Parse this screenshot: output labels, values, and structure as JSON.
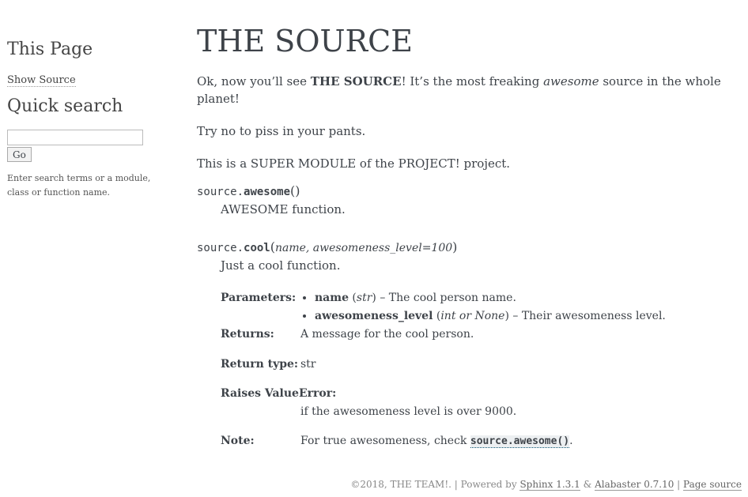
{
  "sidebar": {
    "this_page_title": "This Page",
    "show_source": "Show Source",
    "quick_search_title": "Quick search",
    "search_value": "",
    "go_label": "Go",
    "help_text": "Enter search terms or a module, class or function name."
  },
  "main": {
    "title": "THE SOURCE",
    "intro": {
      "part1": "Ok, now you’ll see ",
      "bold": "THE SOURCE",
      "part2": "! It’s the most freaking ",
      "em": "awesome",
      "part3": " source in the whole planet!"
    },
    "p2": "Try no to piss in your pants.",
    "p3": "This is a SUPER MODULE of the PROJECT! project.",
    "func1": {
      "module": "source.",
      "name": "awesome",
      "open": "(",
      "params": "",
      "close": ")",
      "desc": "AWESOME function."
    },
    "func2": {
      "module": "source.",
      "name": "cool",
      "open": "(",
      "params": "name, awesomeness_level=100",
      "close": ")",
      "desc": "Just a cool function.",
      "fields": {
        "parameters_label": "Parameters:",
        "param1_name": "name",
        "param1_type_open": " (",
        "param1_type": "str",
        "param1_type_close": ")",
        "param1_desc": " – The cool person name.",
        "param2_name": "awesomeness_level",
        "param2_type_open": " (",
        "param2_type": "int or None",
        "param2_type_close": ")",
        "param2_desc": " – Their awesomeness level.",
        "returns_label": "Returns:",
        "returns_value": "A message for the cool person.",
        "rtype_label": "Return type:",
        "rtype_value": "str",
        "raises_label": "Raises ValueError:",
        "raises_value": "if the awesomeness level is over 9000.",
        "note_label": "Note:",
        "note_text": "For true awesomeness, check ",
        "note_ref": "source.awesome()",
        "note_end": "."
      }
    }
  },
  "footer": {
    "copyright": "©2018, THE TEAM!.",
    "sep1": " | ",
    "powered": "Powered by ",
    "sphinx": "Sphinx 1.3.1",
    "amp": " & ",
    "alabaster": "Alabaster 0.7.10",
    "sep2": " | ",
    "page_source": "Page source"
  }
}
